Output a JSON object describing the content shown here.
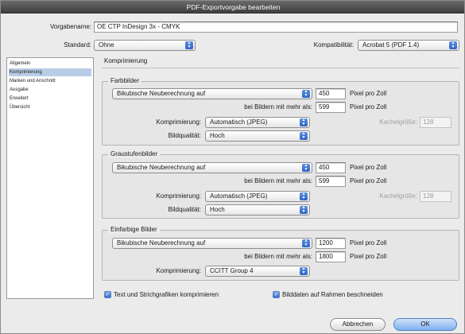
{
  "window": {
    "title": "PDF-Exportvorgabe bearbeiten"
  },
  "preset": {
    "label": "Vorgabename:",
    "value": "OE CTP InDesign 3x - CMYK"
  },
  "standard": {
    "label": "Standard:",
    "value": "Ohne"
  },
  "compat": {
    "label": "Kompatibilität:",
    "value": "Acrobat 5 (PDF 1.4)"
  },
  "sidebar": {
    "items": [
      {
        "label": "Allgemein",
        "selected": false
      },
      {
        "label": "Komprimierung",
        "selected": true
      },
      {
        "label": "Marken und Anschnitt",
        "selected": false
      },
      {
        "label": "Ausgabe",
        "selected": false
      },
      {
        "label": "Erweitert",
        "selected": false
      },
      {
        "label": "Übersicht",
        "selected": false
      }
    ]
  },
  "section": {
    "title": "Komprimierung"
  },
  "color": {
    "title": "Farbbilder",
    "resample": "Bikubische Neuberechnung auf",
    "ppi": "450",
    "ppi_unit": "Pixel pro Zoll",
    "above_label": "bei Bildern mit mehr als:",
    "above": "599",
    "above_unit": "Pixel pro Zoll",
    "compression_label": "Komprimierung:",
    "compression": "Automatisch (JPEG)",
    "tile_label": "Kachelgröße:",
    "tile": "128",
    "quality_label": "Bildqualität:",
    "quality": "Hoch"
  },
  "gray": {
    "title": "Graustufenbilder",
    "resample": "Bikubische Neuberechnung auf",
    "ppi": "450",
    "ppi_unit": "Pixel pro Zoll",
    "above_label": "bei Bildern mit mehr als:",
    "above": "599",
    "above_unit": "Pixel pro Zoll",
    "compression_label": "Komprimierung:",
    "compression": "Automatisch (JPEG)",
    "tile_label": "Kachelgröße:",
    "tile": "128",
    "quality_label": "Bildqualität:",
    "quality": "Hoch"
  },
  "mono": {
    "title": "Einfarbige Bilder",
    "resample": "Bikubische Neuberechnung auf",
    "ppi": "1200",
    "ppi_unit": "Pixel pro Zoll",
    "above_label": "bei Bildern mit mehr als:",
    "above": "1800",
    "above_unit": "Pixel pro Zoll",
    "compression_label": "Komprimierung:",
    "compression": "CCITT Group 4"
  },
  "options": {
    "compress_text": {
      "label": "Text und Strichgrafiken komprimieren",
      "checked": true
    },
    "crop_images": {
      "label": "Bilddaten auf Rahmen beschneiden",
      "checked": true
    }
  },
  "buttons": {
    "cancel": "Abbrechen",
    "ok": "OK"
  }
}
